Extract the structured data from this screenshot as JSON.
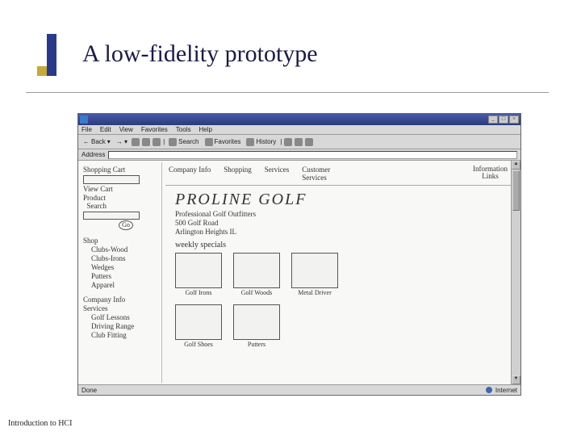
{
  "slide": {
    "title": "A low-fidelity prototype",
    "footer": "Introduction to HCI"
  },
  "browser": {
    "menus": {
      "file": "File",
      "edit": "Edit",
      "view": "View",
      "favorites": "Favorites",
      "tools": "Tools",
      "help": "Help"
    },
    "toolbar": {
      "back": "Back",
      "search": "Search",
      "favorites": "Favorites",
      "history": "History"
    },
    "address_label": "Address",
    "status": {
      "left": "Done",
      "right": "Internet"
    }
  },
  "sidebar": {
    "shopping_cart": "Shopping Cart",
    "view_cart": "View Cart",
    "product_search": "Product\n  Search",
    "go": "Go",
    "shop": "Shop",
    "clubs_wood": "Clubs-Wood",
    "clubs_irons": "Clubs-Irons",
    "wedges": "Wedges",
    "putters": "Putters",
    "apparel": "Apparel",
    "company_info": "Company Info",
    "services": "Services",
    "golf_lessons": "Golf Lessons",
    "driving_range": "Driving Range",
    "club_fitting": "Club Fitting"
  },
  "top_nav": {
    "company_info": "Company Info",
    "shopping": "Shopping",
    "services": "Services",
    "customer_services": "Customer\nServices",
    "information_links": "Information\nLinks"
  },
  "hero": {
    "title": "PROLINE GOLF",
    "subtitle1": "Professional Golf Outfitters",
    "subtitle2": "500 Golf Road",
    "subtitle3": "Arlington Heights IL"
  },
  "specials": {
    "label": "weekly specials",
    "items": [
      "Golf Irons",
      "Golf Woods",
      "Metal Driver",
      "Golf Shoes",
      "Putters"
    ]
  }
}
